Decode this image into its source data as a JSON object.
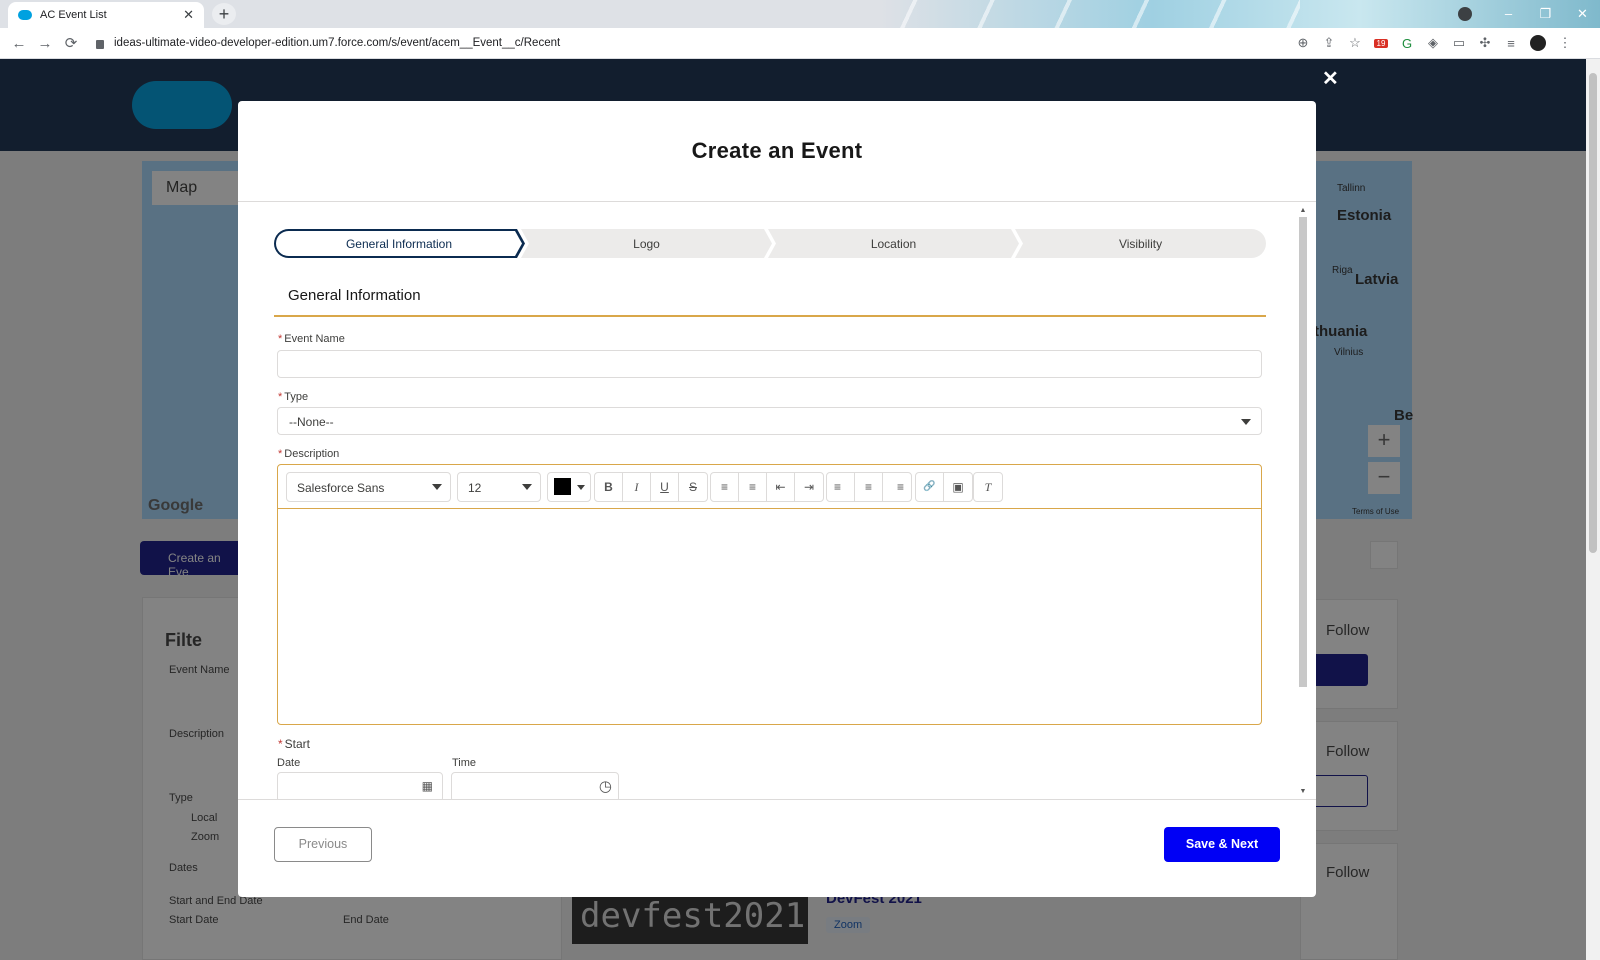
{
  "browser": {
    "tab_title": "AC Event List",
    "new_tab": "+",
    "url": "ideas-ultimate-video-developer-edition.um7.force.com/s/event/acem__Event__c/Recent",
    "ext_badge": "19",
    "window_controls": [
      "–",
      "❐",
      "✕"
    ]
  },
  "background": {
    "map_tab": "Map",
    "create_button": "Create an Eve",
    "filter_title": "Filte",
    "filter_labels": [
      "Event Name",
      "Description",
      "Type",
      "Local",
      "Zoom",
      "Dates",
      "Start and End Date",
      "Start Date",
      "End Date"
    ],
    "follow_label": "Follow",
    "map_labels": [
      "Tallinn",
      "Estonia",
      "Riga",
      "Latvia",
      "thuania",
      "Vilnius",
      "Be"
    ],
    "google": "Google",
    "terms": "Terms of Use",
    "devfest_banner": "devfest2021",
    "devfest_title": "DevFest 2021",
    "devfest_tag": "Zoom"
  },
  "modal": {
    "close": "✕",
    "title": "Create an Event",
    "steps": [
      "General Information",
      "Logo",
      "Location",
      "Visibility"
    ],
    "active_step": "General Information",
    "section_title": "General Information",
    "required_marker": "*",
    "fields": {
      "event_name_label": "Event Name",
      "event_name_value": "",
      "type_label": "Type",
      "type_value": "--None--",
      "description_label": "Description",
      "font_family": "Salesforce Sans",
      "font_size": "12",
      "start_label": "Start",
      "date_label": "Date",
      "time_label": "Time"
    },
    "toolbar_icons": {
      "bold": "B",
      "italic": "I",
      "underline": "U",
      "strike": "S",
      "bullets": "≡",
      "numbers": "≡",
      "outdent": "⇤",
      "indent": "⇥",
      "align_left": "≡",
      "align_center": "≡",
      "align_right": "≡",
      "link": "🔗",
      "image": "▣",
      "clear": "T"
    },
    "previous_label": "Previous",
    "save_label": "Save & Next"
  },
  "colors": {
    "header_navy": "#0b2b50",
    "accent_gold": "#d9a74a",
    "save_blue": "#0000f5",
    "required_red": "#c23934"
  }
}
